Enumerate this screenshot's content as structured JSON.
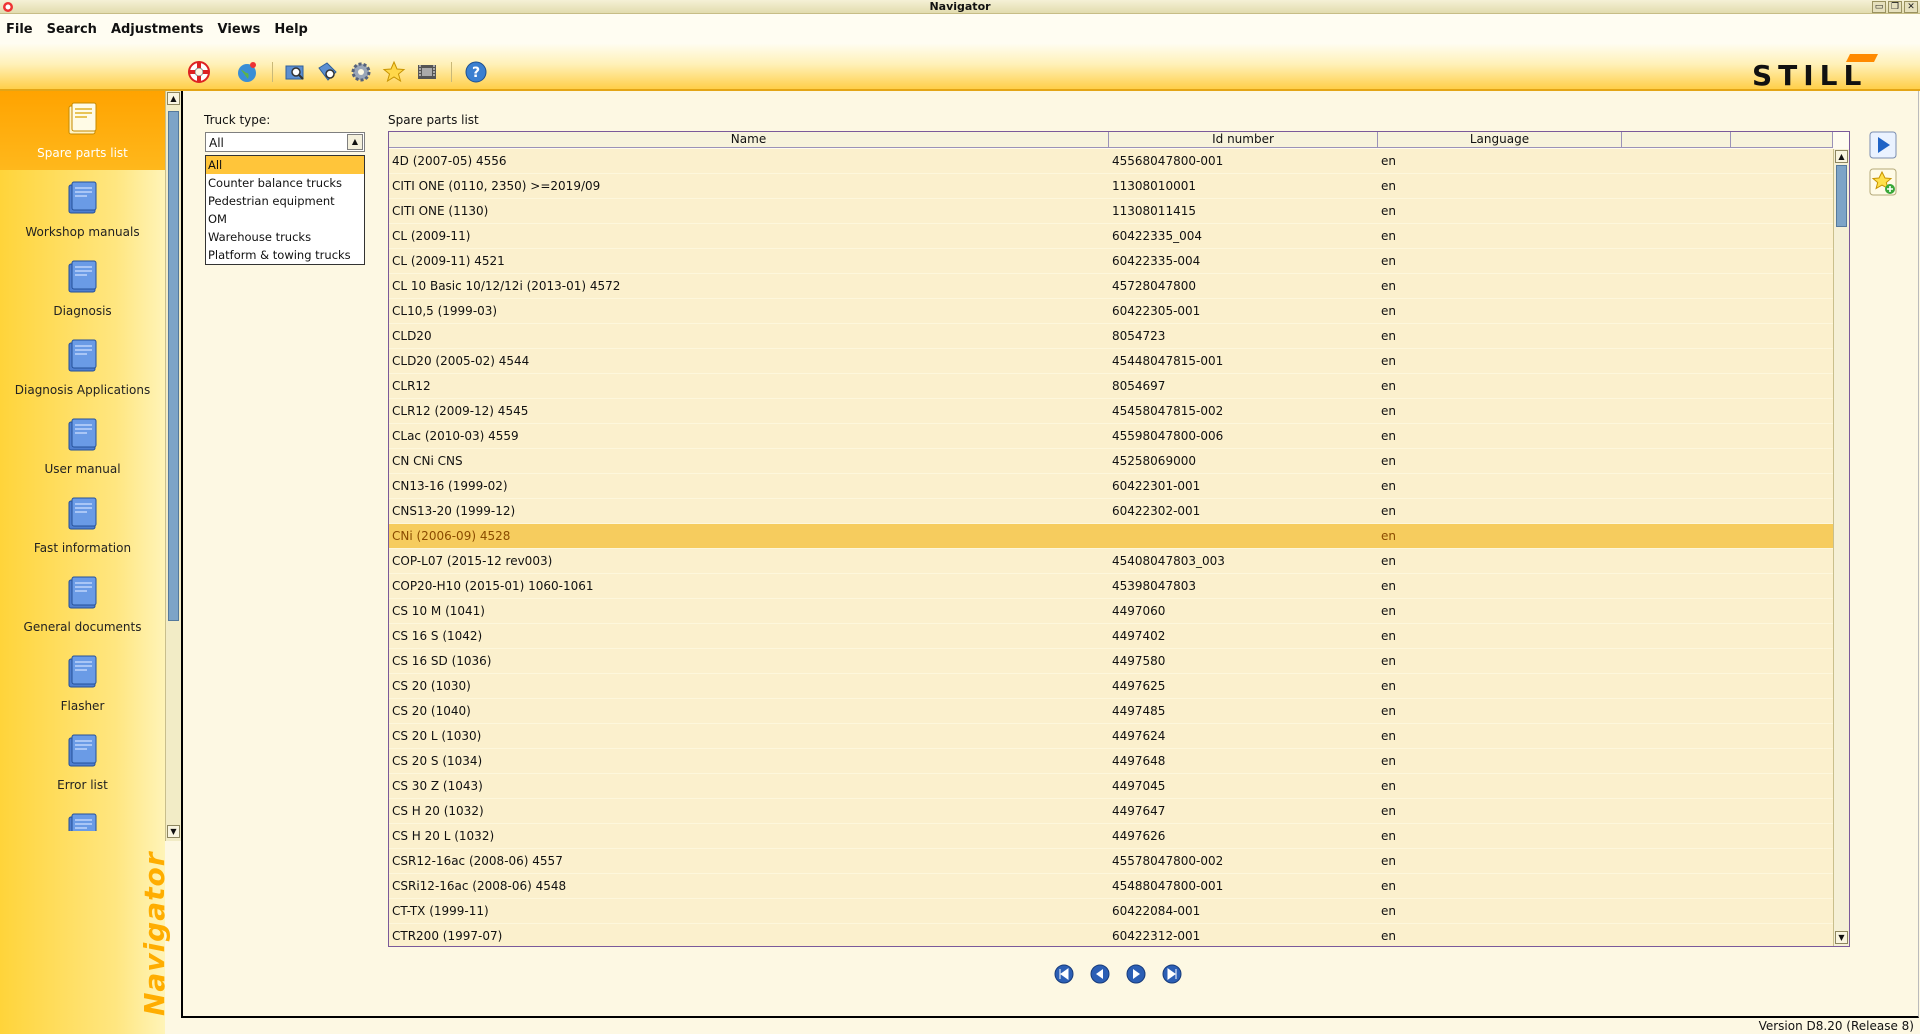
{
  "window": {
    "title": "Navigator",
    "buttons": [
      "▭",
      "❐",
      "✕"
    ]
  },
  "menu": [
    "File",
    "Search",
    "Adjustments",
    "Views",
    "Help"
  ],
  "toolbar": {
    "icons": [
      "lifebuoy-icon",
      "globe-icon",
      "folder-search-icon",
      "tag-search-icon",
      "settings-gear-icon",
      "favorites-star-icon",
      "film-icon",
      "help-icon"
    ]
  },
  "brand": {
    "logo_text": "STILL",
    "logo_color": "#ff8a00",
    "side_text": "Navigator"
  },
  "sidebar": {
    "items": [
      {
        "label": "Spare parts list",
        "active": true
      },
      {
        "label": "Workshop manuals",
        "active": false
      },
      {
        "label": "Diagnosis",
        "active": false
      },
      {
        "label": "Diagnosis Applications",
        "active": false
      },
      {
        "label": "User manual",
        "active": false
      },
      {
        "label": "Fast information",
        "active": false
      },
      {
        "label": "General documents",
        "active": false
      },
      {
        "label": "Flasher",
        "active": false
      },
      {
        "label": "Error list",
        "active": false
      },
      {
        "label": "",
        "active": false
      }
    ]
  },
  "filter": {
    "label": "Truck type:",
    "value": "All",
    "options": [
      "All",
      "Counter balance trucks",
      "Pedestrian equipment",
      "OM",
      "Warehouse trucks",
      "Platform & towing trucks"
    ]
  },
  "table": {
    "title": "Spare parts list",
    "columns": [
      "Name",
      "Id number",
      "Language",
      "",
      ""
    ],
    "rows": [
      [
        "4D (2007-05) 4556",
        "45568047800-001",
        "en"
      ],
      [
        "CITI ONE (0110, 2350) >=2019/09",
        "11308010001",
        "en"
      ],
      [
        "CITI ONE (1130)",
        "11308011415",
        "en"
      ],
      [
        "CL (2009-11)",
        "60422335_004",
        "en"
      ],
      [
        "CL (2009-11) 4521",
        "60422335-004",
        "en"
      ],
      [
        "CL 10 Basic 10/12/12i (2013-01) 4572",
        "45728047800",
        "en"
      ],
      [
        "CL10,5 (1999-03)",
        "60422305-001",
        "en"
      ],
      [
        "CLD20",
        "8054723",
        "en"
      ],
      [
        "CLD20 (2005-02) 4544",
        "45448047815-001",
        "en"
      ],
      [
        "CLR12",
        "8054697",
        "en"
      ],
      [
        "CLR12 (2009-12) 4545",
        "45458047815-002",
        "en"
      ],
      [
        "CLac (2010-03) 4559",
        "45598047800-006",
        "en"
      ],
      [
        "CN CNi CNS",
        "45258069000",
        "en"
      ],
      [
        "CN13-16 (1999-02)",
        "60422301-001",
        "en"
      ],
      [
        "CNS13-20 (1999-12)",
        "60422302-001",
        "en"
      ],
      [
        "CNi (2006-09) 4528",
        "",
        "en"
      ],
      [
        "COP-L07 (2015-12 rev003)",
        "45408047803_003",
        "en"
      ],
      [
        "COP20-H10 (2015-01) 1060-1061",
        "45398047803",
        "en"
      ],
      [
        "CS 10 M (1041)",
        "4497060",
        "en"
      ],
      [
        "CS 16 S (1042)",
        "4497402",
        "en"
      ],
      [
        "CS 16 SD (1036)",
        "4497580",
        "en"
      ],
      [
        "CS 20 (1030)",
        "4497625",
        "en"
      ],
      [
        "CS 20 (1040)",
        "4497485",
        "en"
      ],
      [
        "CS 20 L (1030)",
        "4497624",
        "en"
      ],
      [
        "CS 20 S (1034)",
        "4497648",
        "en"
      ],
      [
        "CS 30 Z (1043)",
        "4497045",
        "en"
      ],
      [
        "CS H 20 (1032)",
        "4497647",
        "en"
      ],
      [
        "CS H 20 L (1032)",
        "4497626",
        "en"
      ],
      [
        "CSR12-16ac (2008-06) 4557",
        "45578047800-002",
        "en"
      ],
      [
        "CSRi12-16ac (2008-06) 4548",
        "45488047800-001",
        "en"
      ],
      [
        "CT-TX (1999-11)",
        "60422084-001",
        "en"
      ],
      [
        "CTR200 (1997-07)",
        "60422312-001",
        "en"
      ]
    ],
    "selected_row": 15
  },
  "pager": [
    "first-page-icon",
    "previous-page-icon",
    "next-page-icon",
    "last-page-icon"
  ],
  "actions": [
    "open-arrow-icon",
    "add-favorite-icon"
  ],
  "status": {
    "version": "Version D8.20 (Release 8)"
  }
}
